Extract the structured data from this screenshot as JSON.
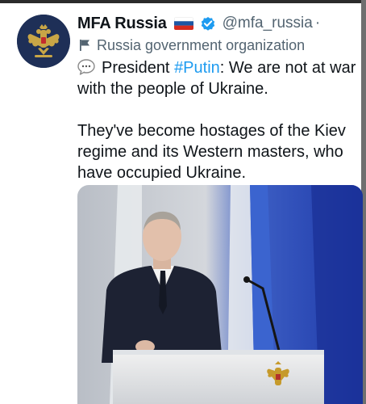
{
  "tweet": {
    "author": {
      "display_name": "MFA Russia",
      "handle": "@mfa_russia",
      "separator": "·",
      "label": "Russia government organization",
      "flag_icon": "russia-flag-icon",
      "verified_icon": "verified-badge-icon",
      "avatar_icon": "double-headed-eagle-emblem"
    },
    "text": {
      "emoji_icon": "speech-balloon-icon",
      "line1_prefix": "President ",
      "hashtag": "#Putin",
      "line1_suffix": ": We are not at war",
      "line2": "with the people of Ukraine.",
      "line3": "They've become hostages of the Kiev",
      "line4": "regime and its Western masters, who",
      "line5": "have occupied Ukraine."
    },
    "media": {
      "type": "photo",
      "subject": "speaker-at-podium"
    }
  },
  "colors": {
    "text": "#0f1419",
    "secondary": "#536471",
    "link": "#1d9bf0",
    "verified": "#1d9bf0",
    "flag_white": "#ffffff",
    "flag_blue": "#1c57a5",
    "flag_red": "#d52b1e"
  }
}
